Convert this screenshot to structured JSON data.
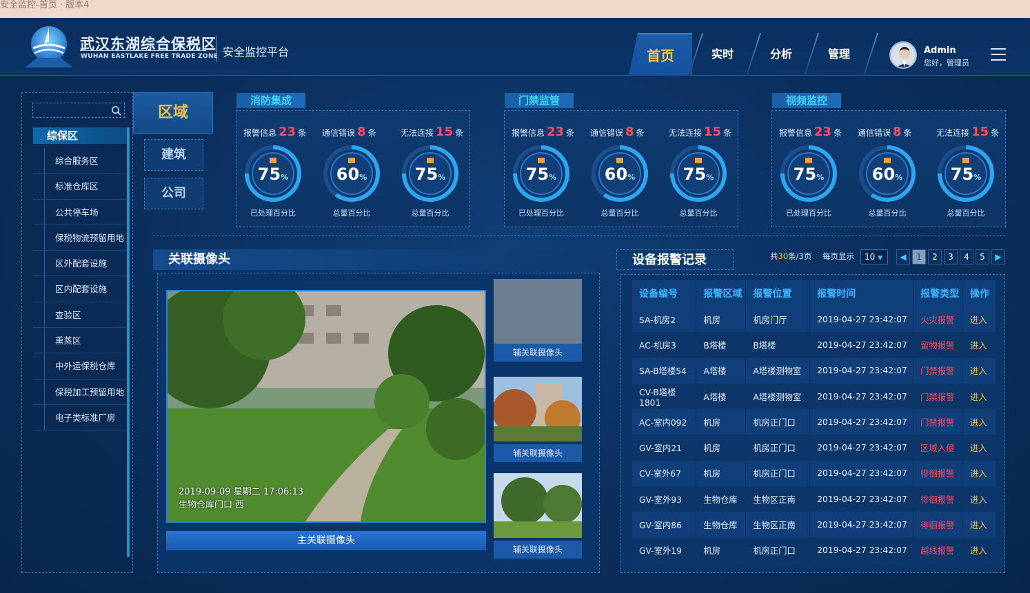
{
  "window_title": "安全监控-首页 · 版本4",
  "brand": {
    "cn": "武汉东湖综合保税区",
    "en": "WUHAN EASTLAKE FREE TRADE ZONE",
    "platform": "安全监控平台"
  },
  "nav": [
    {
      "label": "首页",
      "active": true
    },
    {
      "label": "实时",
      "active": false
    },
    {
      "label": "分析",
      "active": false
    },
    {
      "label": "管理",
      "active": false
    }
  ],
  "user": {
    "name": "Admin",
    "greeting": "您好，管理员"
  },
  "sidebar": {
    "search_placeholder": "",
    "category_main": "区域",
    "category_subs": [
      "建筑",
      "公司"
    ],
    "group_title": "综保区",
    "items": [
      "综合服务区",
      "标准仓库区",
      "公共停车场",
      "保税物流预留用地",
      "区外配套设施",
      "区内配套设施",
      "查验区",
      "熏蒸区",
      "中外运保税仓库",
      "保税加工预留用地",
      "电子类标准厂房"
    ]
  },
  "stats": [
    {
      "title": "消防集成",
      "labels": [
        {
          "pre": "报警信息",
          "num": "23",
          "post": "条"
        },
        {
          "pre": "通信错误",
          "num": "8",
          "post": "条"
        },
        {
          "pre": "无法连接",
          "num": "15",
          "post": "条"
        }
      ],
      "gauges": [
        {
          "value": "75",
          "unit": "%",
          "caption": "已处理百分比",
          "fraction": 0.75
        },
        {
          "value": "60",
          "unit": "%",
          "caption": "总量百分比",
          "fraction": 0.6
        },
        {
          "value": "75",
          "unit": "%",
          "caption": "总量百分比",
          "fraction": 0.75
        }
      ]
    },
    {
      "title": "门禁监管",
      "labels": [
        {
          "pre": "报警信息",
          "num": "23",
          "post": "条"
        },
        {
          "pre": "通信错误",
          "num": "8",
          "post": "条"
        },
        {
          "pre": "无法连接",
          "num": "15",
          "post": "条"
        }
      ],
      "gauges": [
        {
          "value": "75",
          "unit": "%",
          "caption": "已处理百分比",
          "fraction": 0.75
        },
        {
          "value": "60",
          "unit": "%",
          "caption": "总量百分比",
          "fraction": 0.6
        },
        {
          "value": "75",
          "unit": "%",
          "caption": "总量百分比",
          "fraction": 0.75
        }
      ]
    },
    {
      "title": "视频监控",
      "labels": [
        {
          "pre": "报警信息",
          "num": "23",
          "post": "条"
        },
        {
          "pre": "通信错误",
          "num": "8",
          "post": "条"
        },
        {
          "pre": "无法连接",
          "num": "15",
          "post": "条"
        }
      ],
      "gauges": [
        {
          "value": "75",
          "unit": "%",
          "caption": "已处理百分比",
          "fraction": 0.75
        },
        {
          "value": "60",
          "unit": "%",
          "caption": "总量百分比",
          "fraction": 0.6
        },
        {
          "value": "75",
          "unit": "%",
          "caption": "总量百分比",
          "fraction": 0.75
        }
      ]
    }
  ],
  "camera": {
    "title": "关联摄像头",
    "timestamp": "2019-09-09  星期二  17:06:13",
    "location": "生物仓库门口   西",
    "main_label": "主关联摄像头",
    "aux_labels": [
      "辅关联摄像头",
      "辅关联摄像头",
      "辅关联摄像头"
    ]
  },
  "alarms": {
    "title": "设备报警记录",
    "total_pre": "共",
    "total_num": "30",
    "total_mid": "条/",
    "pages_num": "3",
    "pages_post": "页",
    "per_page_label": "每页显示",
    "per_page": "10",
    "pages": [
      "1",
      "2",
      "3",
      "4",
      "5"
    ],
    "prev": "◀",
    "next": "▶",
    "headers": [
      "设备编号",
      "报警区域",
      "报警位置",
      "报警时间",
      "报警类型",
      "操作"
    ],
    "rows": [
      [
        "SA-机房2",
        "机房",
        "机房门厅",
        "2019-04-27 23:42:07",
        "火灾报警",
        "进入"
      ],
      [
        "AC-机房3",
        "B塔楼",
        "B塔楼",
        "2019-04-27 23:42:07",
        "留物报警",
        "进入"
      ],
      [
        "SA-B塔楼54",
        "A塔楼",
        "A塔楼测物室",
        "2019-04-27 23:42:07",
        "门禁报警",
        "进入"
      ],
      [
        "CV-B塔楼1801",
        "A塔楼",
        "A塔楼测物室",
        "2019-04-27 23:42:07",
        "门禁报警",
        "进入"
      ],
      [
        "AC-室内092",
        "机房",
        "机房正门口",
        "2019-04-27 23:42:07",
        "门禁报警",
        "进入"
      ],
      [
        "GV-室内21",
        "机房",
        "机房正门口",
        "2019-04-27 23:42:07",
        "区域入侵",
        "进入"
      ],
      [
        "CV-室外67",
        "机房",
        "机房正门口",
        "2019-04-27 23:42:07",
        "徘徊报警",
        "进入"
      ],
      [
        "GV-室外93",
        "生物仓库",
        "生物区正南",
        "2019-04-27 23:42:07",
        "徘徊报警",
        "进入"
      ],
      [
        "GV-室内86",
        "生物仓库",
        "生物区正南",
        "2019-04-27 23:42:07",
        "徘徊报警",
        "进入"
      ],
      [
        "GV-室外19",
        "机房",
        "机房正门口",
        "2019-04-27 23:42:07",
        "越线报警",
        "进入"
      ]
    ]
  },
  "colors": {
    "accent_gold": "#f6c445",
    "alarm_red": "#ff4b5e",
    "cyan": "#45d3f0",
    "bg": "#0a2e5c"
  }
}
